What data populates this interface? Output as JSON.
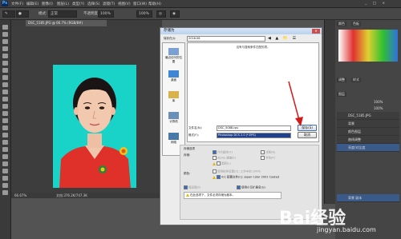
{
  "app": {
    "logo": "Ps",
    "menus": [
      "文件(F)",
      "编辑(E)",
      "图像(I)",
      "图层(L)",
      "类型(Y)",
      "选择(S)",
      "滤镜(T)",
      "视图(V)",
      "窗口(W)",
      "帮助(H)"
    ]
  },
  "options": {
    "mode_label": "模式:",
    "mode_value": "正常",
    "opacity_label": "不透明度:",
    "opacity_value": "100%",
    "flow_value": "100%"
  },
  "document": {
    "tab_title": "DSC_5185.JPG @ 66.7% (RGB/8#)",
    "zoom": "66.67%",
    "status": "文档:376.2K/747.3K"
  },
  "right_panel": {
    "tab_color": "颜色",
    "tab_swatches": "色板",
    "tab_adjust": "调整",
    "tab_styles": "样式",
    "layers_tab": "图层",
    "opacity_value": "100%",
    "fill_value": "100%",
    "layers": [
      "DSC_5185.JPG",
      "背景",
      "颜色图层",
      "曲线调整",
      "亮度/对比度"
    ],
    "bottom_label": "背景 副本"
  },
  "dialog": {
    "title": "存储为",
    "save_in_label": "保存在(I):",
    "save_in_value": "2016.06",
    "empty_message": "没有与搜索条件匹配的项。",
    "places": [
      "最近访问的位置",
      "桌面",
      "库",
      "计算机",
      "网络"
    ],
    "filename_label": "文件名(N):",
    "filename_value": "DSC_5088.cps",
    "format_label": "格式(F):",
    "format_value": "Photoshop DCS 2.0 (*.EPS)",
    "save_button": "保存(S)",
    "cancel_button": "取消",
    "save_options_label": "存储选项",
    "store_label": "存储:",
    "as_copy": "作为副本(Y)",
    "notes": "注释(N)",
    "alpha": "Alpha 通道(E)",
    "spot": "专色(P)",
    "layers": "图层(L)",
    "color_label": "颜色:",
    "proof": "使用校样设置(O): 工作中的 CMYK",
    "icc": "ICC 配置文件(C): Japan Color 2001 Coated",
    "thumbnail": "缩览图(T)",
    "lowercase": "使用小写扩展名(U)",
    "warning": "在此选项下，文件必须存储为副本。"
  },
  "watermark": {
    "brand": "Bai经验",
    "url": "jingyan.baidu.com"
  },
  "colors": {
    "ps_bg": "#535353",
    "photo_bg": "#1ad3c8",
    "shirt": "#e0302a",
    "arrow": "#d11a1a"
  }
}
